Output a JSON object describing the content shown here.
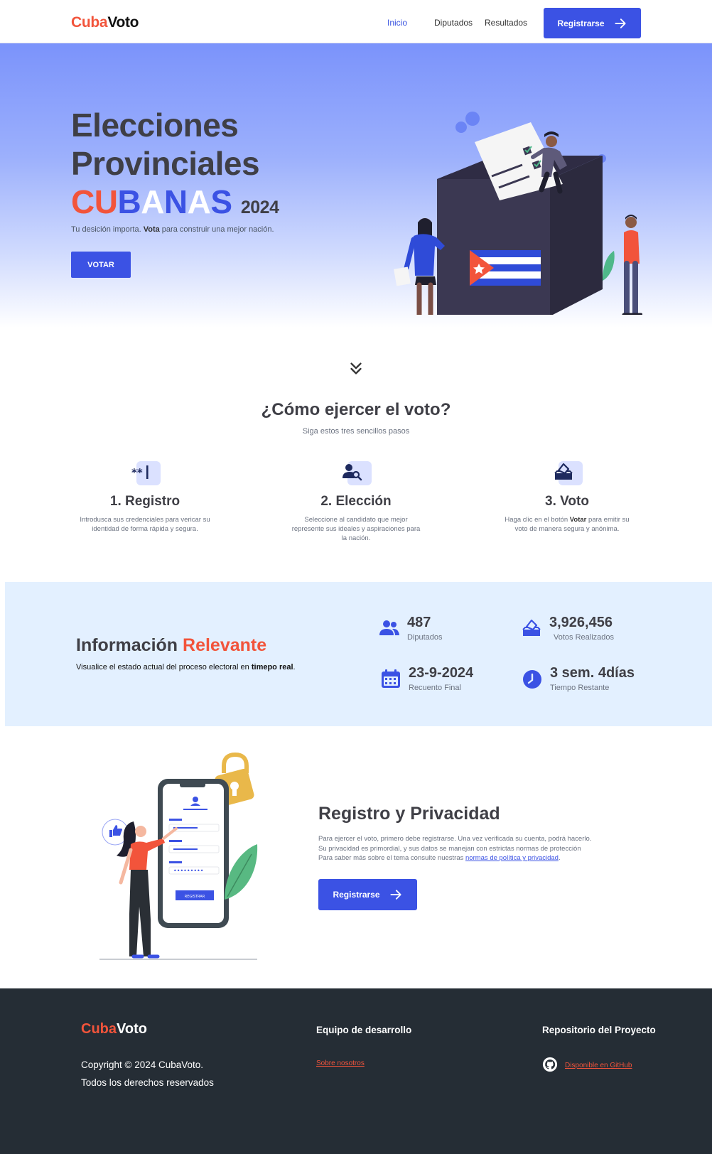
{
  "nav": {
    "logo_a": "Cuba",
    "logo_b": "Voto",
    "links": [
      "Inicio",
      "Diputados",
      "Resultados"
    ],
    "register_label": "Registrarse"
  },
  "hero": {
    "line1": "Elecciones",
    "line2": "Provinciales",
    "cubanas": [
      "CU",
      "B",
      "A",
      "N",
      "A",
      "S"
    ],
    "year": "2024",
    "sub_a": "Tu desición importa. ",
    "sub_b": "Vota",
    "sub_c": " para construir una mejor nación.",
    "cta": "VOTAR"
  },
  "steps": {
    "title": "¿Cómo ejercer el voto?",
    "subtitle": "Siga estos tres sencillos pasos",
    "items": [
      {
        "icon": "password-icon",
        "title": "1. Registro",
        "text": "Introdusca sus credenciales para vericar su identidad de forma rápida y segura."
      },
      {
        "icon": "user-search-icon",
        "title": "2. Elección",
        "text": "Seleccione al candidato que mejor represente sus ideales y aspiraciones para la nación."
      },
      {
        "icon": "ballot-box-icon",
        "title": "3. Voto",
        "text_a": "Haga clic en el botón ",
        "text_b": "Votar",
        "text_c": " para emitir su voto de manera segura y anónima."
      }
    ]
  },
  "info": {
    "title_a": "Información ",
    "title_b": "Relevante",
    "sub_a": "Visualice el estado actual del proceso electoral en ",
    "sub_b": "timepo real",
    "sub_c": ".",
    "stats": [
      {
        "icon": "users-icon",
        "value": "487",
        "label": "Diputados"
      },
      {
        "icon": "ballot-box-icon",
        "value": "3,926,456",
        "label": "Votos Realizados"
      },
      {
        "icon": "calendar-icon",
        "value": "23-9-2024",
        "label": "Recuento Final"
      },
      {
        "icon": "clock-icon",
        "value": "3 sem. 4días",
        "label": "Tiempo Restante"
      }
    ]
  },
  "registro": {
    "title": "Registro y Privacidad",
    "line1": "Para ejercer el voto, primero debe registrarse. Una vez verificada su cuenta, podrá hacerlo.",
    "line2": "Su privacidad es primordial, y sus datos se manejan con estrictas normas de protección",
    "line3": "Para saber más sobre el tema consulte nuestras ",
    "link": "normas de política y privacidad",
    "line3_end": ".",
    "cta": "Registrarse",
    "phone_button": "REGISTRAR"
  },
  "footer": {
    "logo_a": "Cuba",
    "logo_b": "Voto",
    "copy1": "Copyright © 2024 CubaVoto.",
    "copy2": "Todos los derechos reservados",
    "team_heading": "Equipo de desarrollo",
    "team_link": "Sobre nosotros",
    "repo_heading": "Repositorio del Proyecto",
    "repo_link": "Disponible en GitHub"
  },
  "colors": {
    "brand_blue": "#3b52e4",
    "brand_red": "#f2543b",
    "footer_bg": "#252d35",
    "info_bg": "#e3f0ff"
  }
}
